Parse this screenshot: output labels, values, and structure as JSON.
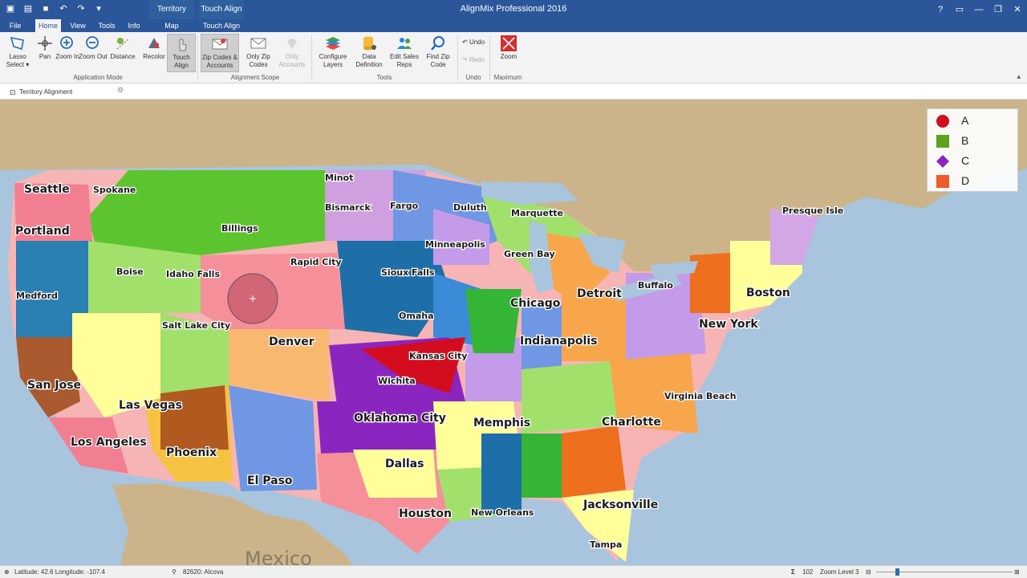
{
  "title_bar": {
    "app_title": "AlignMix Professional 2016",
    "context_tab_map": "Territory Map",
    "context_tab_touch": "Touch Align",
    "window_buttons": [
      "?",
      "▭",
      "—",
      "❐",
      "✕"
    ]
  },
  "tabs": {
    "file": "File",
    "home": "Home",
    "view": "View",
    "tools": "Tools",
    "info": "Info",
    "map": "Map",
    "touch_align": "Touch Align"
  },
  "ribbon": {
    "lasso": "Lasso Select ▾",
    "pan": "Pan",
    "zoom_in": "Zoom In",
    "zoom_out": "Zoom Out",
    "distance": "Distance",
    "recolor": "Recolor",
    "touch_align": "Touch Align",
    "zip_accounts": "Zip Codes & Accounts",
    "only_zip": "Only Zip Codes",
    "only_accounts": "Only Accounts",
    "configure_layers": "Configure Layers",
    "data_definition": "Data Definition",
    "edit_sales_reps": "Edit Sales Reps",
    "find_zip": "Find Zip Code",
    "undo": "Undo",
    "redo": "Redo",
    "zoom": "Zoom",
    "group_application_mode": "Application Mode",
    "group_alignment_scope": "Alignment Scope",
    "group_tools": "Tools",
    "group_undo": "Undo",
    "group_maximum": "Maximum"
  },
  "doc_tab": {
    "label": "Territory Alignment"
  },
  "legend": [
    {
      "label": "A",
      "color": "#d40d1e",
      "shape": "circle"
    },
    {
      "label": "B",
      "color": "#5ba41b",
      "shape": "square"
    },
    {
      "label": "C",
      "color": "#8b25c0",
      "shape": "diamond"
    },
    {
      "label": "D",
      "color": "#ee5a2a",
      "shape": "square"
    }
  ],
  "map": {
    "cities_small": [
      "Minot",
      "Spokane",
      "Bismarck",
      "Fargo",
      "Duluth",
      "Marquette",
      "Presque Isle",
      "Billings",
      "Minneapolis",
      "Green Bay",
      "Rapid City",
      "Boise",
      "Idaho Falls",
      "Sioux Falls",
      "Buffalo",
      "Medford",
      "Salt Lake City",
      "Omaha",
      "Kansas City",
      "Wichita",
      "Virginia Beach",
      "New Orleans",
      "Tampa"
    ],
    "cities_large": [
      "Seattle",
      "Portland",
      "Chicago",
      "Detroit",
      "Boston",
      "New York",
      "Indianapolis",
      "Denver",
      "San Jose",
      "Las Vegas",
      "Oklahoma City",
      "Memphis",
      "Charlotte",
      "Los Angeles",
      "Phoenix",
      "Dallas",
      "El Paso",
      "Houston",
      "Jacksonville",
      "Mexico"
    ]
  },
  "status": {
    "coords": "Latitude: 42.6 Longitude: -107.4",
    "zip": "82620: Alcova",
    "count": "102",
    "zoom_level": "Zoom Level 3"
  }
}
